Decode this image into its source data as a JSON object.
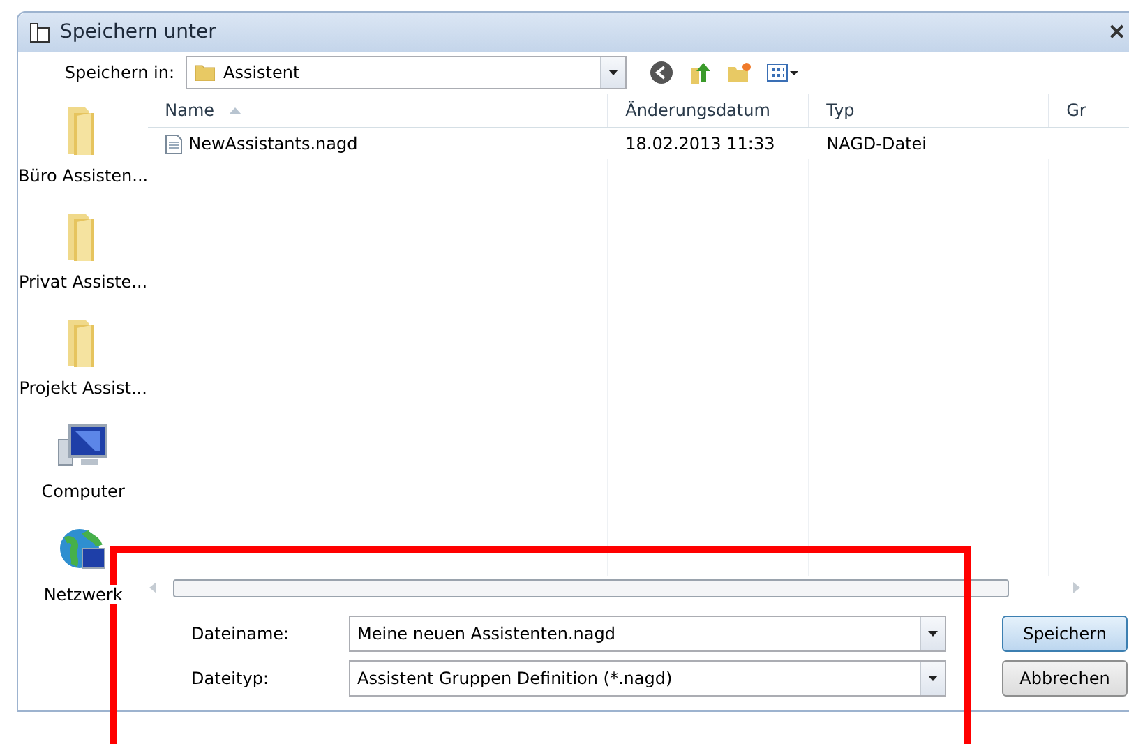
{
  "window": {
    "title": "Speichern unter",
    "close": "✕"
  },
  "location": {
    "label": "Speichern in:",
    "value": "Assistent"
  },
  "places": [
    {
      "kind": "folder",
      "label": "Büro Assisten..."
    },
    {
      "kind": "folder",
      "label": "Privat Assiste..."
    },
    {
      "kind": "folder",
      "label": "Projekt Assist..."
    },
    {
      "kind": "computer",
      "label": "Computer"
    },
    {
      "kind": "network",
      "label": "Netzwerk"
    }
  ],
  "table": {
    "columns": [
      "Name",
      "Änderungsdatum",
      "Typ",
      "Gr"
    ],
    "rows": [
      {
        "selected": false,
        "cells": [
          "NewAssistants.nagd",
          "18.02.2013 11:33",
          "NAGD-Datei"
        ]
      }
    ]
  },
  "filename": {
    "label": "Dateiname:",
    "value": "Meine neuen Assistenten.nagd"
  },
  "filetype": {
    "label": "Dateityp:",
    "value": "Assistent Gruppen Definition (*.nagd)"
  },
  "buttons": [
    {
      "label": "Speichern",
      "default": true
    },
    {
      "label": "Abbrechen",
      "default": false
    }
  ]
}
